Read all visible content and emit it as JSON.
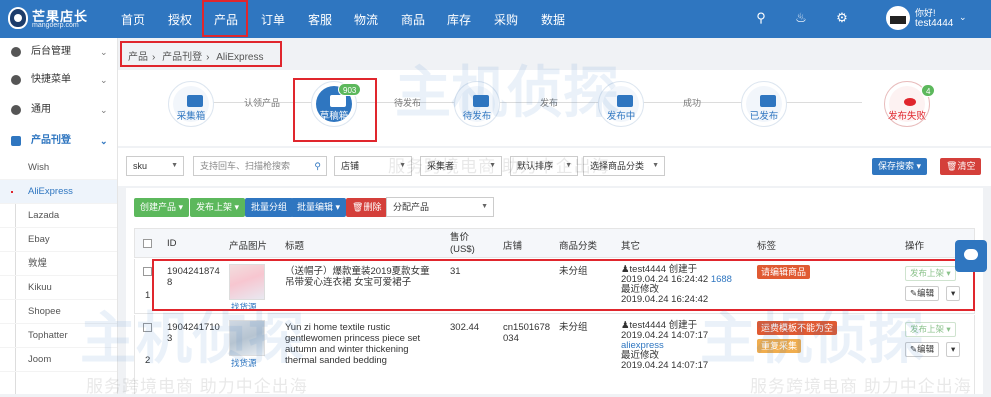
{
  "topnav": {
    "logo_title": "芒果店长",
    "logo_sub": "mangoerp.com",
    "items": [
      "首页",
      "授权",
      "产品",
      "订单",
      "客服",
      "物流",
      "商品",
      "库存",
      "采购",
      "数据"
    ],
    "user_hi": "你好!",
    "user_name": "test4444"
  },
  "sidebar": {
    "items": [
      {
        "label": "后台管理",
        "icon": "gear-icon"
      },
      {
        "label": "快捷菜单",
        "icon": "settings-icon"
      },
      {
        "label": "通用",
        "icon": "gear-icon"
      }
    ],
    "section": {
      "label": "产品刊登",
      "icon": "edit-icon"
    },
    "subitems": [
      "Wish",
      "AliExpress",
      "Lazada",
      "Ebay",
      "敦煌",
      "Kikuu",
      "Shopee",
      "Tophatter",
      "Joom"
    ],
    "active_sub": "AliExpress"
  },
  "breadcrumb": [
    "产品",
    "产品刊登",
    "AliExpress"
  ],
  "flow": {
    "steps": [
      {
        "label": "采集箱",
        "badge": ""
      },
      {
        "label": "草稿箱",
        "badge": "903"
      },
      {
        "label": "待发布",
        "badge": ""
      },
      {
        "label": "发布中",
        "badge": ""
      },
      {
        "label": "已发布",
        "badge": ""
      },
      {
        "label": "发布失败",
        "badge": "4"
      }
    ],
    "arrows": [
      "认领产品",
      "待发布",
      "发布",
      "成功"
    ]
  },
  "filters": {
    "field_select": "sku",
    "search_placeholder": "支持回车、扫描枪搜索",
    "shop_select": "店铺",
    "creator_select": "采集者",
    "sort_select": "默认排序",
    "category_select": "选择商品分类",
    "save_search": "保存搜索",
    "clear": "清空"
  },
  "toolbar": {
    "create": "创建产品",
    "publish": "发布上架",
    "batch_group": "批量分组",
    "batch_edit": "批量编辑",
    "delete": "删除",
    "assign_select": "分配产品"
  },
  "table": {
    "headers": [
      "ID",
      "产品图片",
      "标题",
      "售价(US$)",
      "店铺",
      "商品分类",
      "其它",
      "标签",
      "操作"
    ],
    "rows": [
      {
        "index": "1",
        "id_line1": "1904241874",
        "id_line2": "8",
        "image_label": "找货源",
        "title": "（送帽子）爆款童装2019夏款女童吊带爱心连衣裙 女宝可爱裙子",
        "price": "31",
        "shop": "",
        "category": "未分组",
        "creator": "test4444 创建于",
        "created": "2019.04.24 16:24:42",
        "source": "1688",
        "modified_label": "最近修改",
        "modified": "2019.04.24 16:24:42",
        "tags": [
          "请编辑商品"
        ],
        "op_publish": "发布上架",
        "op_edit": "编辑"
      },
      {
        "index": "2",
        "id_line1": "1904241710",
        "id_line2": "3",
        "image_label": "找货源",
        "title": "Yun zi home textile rustic gentlewomen princess piece set autumn and winter thickening thermal sanded bedding",
        "price": "302.44",
        "shop": "cn1501678034",
        "category": "未分组",
        "creator": "test4444 创建于",
        "created": "2019.04.24 14:07:17",
        "source": "aliexpress",
        "modified_label": "最近修改",
        "modified": "2019.04.24 14:07:17",
        "tags": [
          "运费模板不能为空",
          "重复采集"
        ],
        "op_publish": "发布上架",
        "op_edit": "编辑"
      }
    ]
  },
  "watermark": {
    "text": "主机侦探",
    "sub": "服务跨境电商 助力中企出海"
  },
  "colors": {
    "brand": "#2f76c0",
    "highlight": "#e0262d",
    "success": "#5cb85c",
    "warning": "#f0ad4e"
  }
}
